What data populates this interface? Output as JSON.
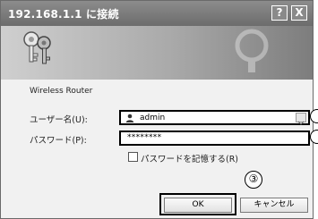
{
  "window": {
    "title": "192.168.1.1 に接続",
    "help_button": "?",
    "close_button": "X"
  },
  "banner": {
    "icon": "keys-icon"
  },
  "form": {
    "site_name": "Wireless Router",
    "username_label": "ユーザー名(U):",
    "username_value": "admin",
    "username_icon": "user-icon",
    "password_label": "パスワード(P):",
    "password_value": "********",
    "remember_label": "パスワードを記憶する(R)",
    "remember_checked": false
  },
  "annotation": {
    "step_marker": "③"
  },
  "buttons": {
    "ok": "OK",
    "cancel": "キャンセル"
  }
}
